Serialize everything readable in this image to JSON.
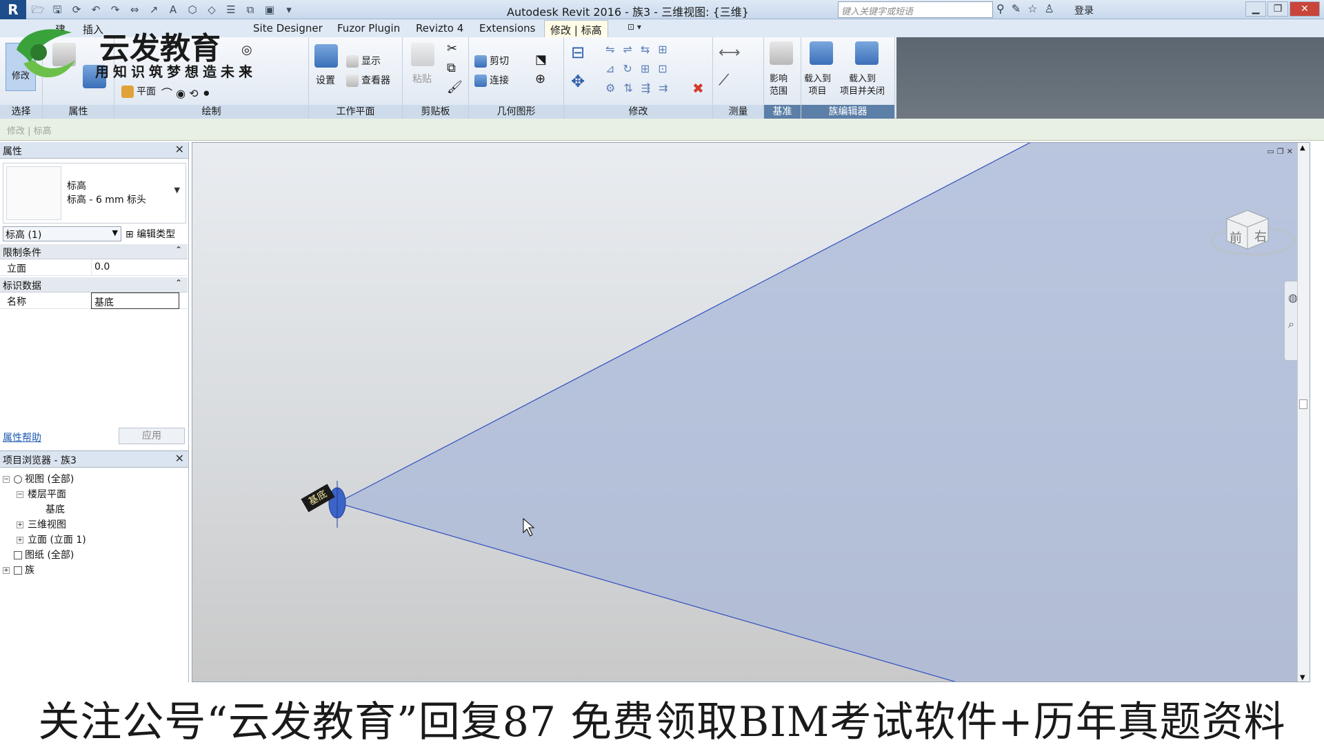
{
  "titlebar": {
    "title": "Autodesk Revit 2016 -    族3 - 三维视图: {三维}",
    "search_placeholder": "键入关键字或短语",
    "login": "登录"
  },
  "tabs": [
    {
      "label": "建"
    },
    {
      "label": "插入"
    },
    {
      "label": "Site Designer"
    },
    {
      "label": "Fuzor Plugin"
    },
    {
      "label": "Revizto 4"
    },
    {
      "label": "Extensions"
    },
    {
      "label": "修改 | 标高"
    }
  ],
  "ribbon": {
    "panels": {
      "select": "选择",
      "properties": "属性",
      "draw": "绘制",
      "workplane": "工作平面",
      "clipboard": "剪贴板",
      "geometry": "几何图形",
      "modify": "修改",
      "measure": "测量",
      "datum": "基准",
      "family_editor": "族编辑器"
    },
    "buttons": {
      "modify": "修改",
      "plane": "平面",
      "set": "设置",
      "show": "显示",
      "viewer": "查看器",
      "paste": "粘贴",
      "cut": "剪切",
      "join": "连接",
      "scope_box": "影响\n范围",
      "load_into_project": "载入到\n项目",
      "load_into_project_close": "载入到\n项目并关闭"
    }
  },
  "optbar": {
    "context": "修改 | 标高"
  },
  "properties": {
    "title": "属性",
    "type_family": "标高",
    "type_name": "标高 - 6 mm 标头",
    "instance_selector": "标高 (1)",
    "edit_type": "编辑类型",
    "groups": [
      {
        "label": "限制条件",
        "rows": [
          {
            "key": "立面",
            "value": "0.0"
          }
        ]
      },
      {
        "label": "标识数据",
        "rows": [
          {
            "key": "名称",
            "value": "基底"
          }
        ]
      }
    ],
    "help_link": "属性帮助",
    "apply": "应用"
  },
  "browser": {
    "title": "项目浏览器 - 族3",
    "nodes": [
      {
        "label": "视图 (全部)",
        "expander": "−"
      },
      {
        "label": "楼层平面",
        "expander": "−"
      },
      {
        "label": "基底",
        "expander": ""
      },
      {
        "label": "三维视图",
        "expander": "+"
      },
      {
        "label": "立面 (立面 1)",
        "expander": "+"
      },
      {
        "label": "图纸 (全部)",
        "expander": ""
      },
      {
        "label": "族",
        "expander": "+"
      }
    ]
  },
  "viewport": {
    "level_label": "基底",
    "viewcube_faces": [
      "前",
      "右"
    ]
  },
  "watermark": {
    "brand": "云发教育",
    "slogan": "用知识筑梦想造未来"
  },
  "banner": {
    "text": "关注公号“云发教育”回复87 免费领取BIM考试软件+历年真题资料"
  },
  "colors": {
    "accent": "#1d4d8a",
    "level_plane": "#a9b8d8",
    "level_line": "#2f4fbf"
  }
}
